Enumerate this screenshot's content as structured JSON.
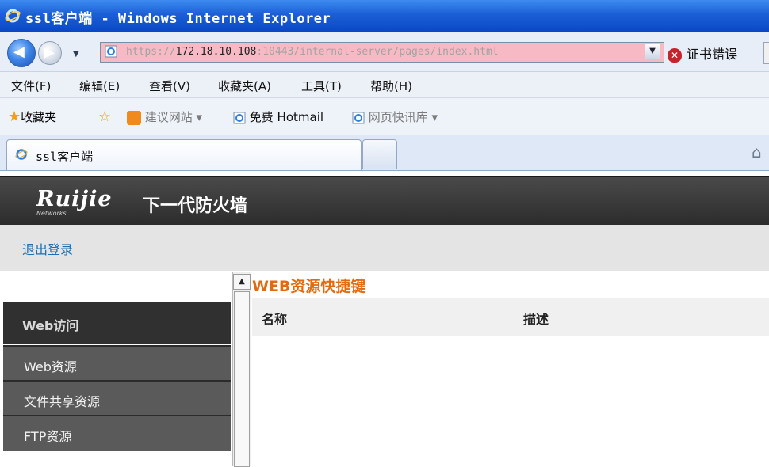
{
  "window": {
    "title": "ssl客户端 - Windows Internet Explorer"
  },
  "address_bar": {
    "scheme": "https://",
    "host": "172.18.10.108",
    "rest": ":10443/internal-server/pages/index.html",
    "cert_error": "证书错误",
    "color_error_bg": "#f7b9c4"
  },
  "menu": [
    "文件(F)",
    "编辑(E)",
    "查看(V)",
    "收藏夹(A)",
    "工具(T)",
    "帮助(H)"
  ],
  "favorites": {
    "label": "收藏夹",
    "items": [
      {
        "label": "建议网站 ▾",
        "icon": "suggested-sites-icon"
      },
      {
        "label": "免费 Hotmail",
        "icon": "ie-page-icon"
      },
      {
        "label": "网页快讯库 ▾",
        "icon": "web-slice-icon"
      }
    ]
  },
  "tab": {
    "label": "ssl客户端"
  },
  "page": {
    "brand": "Ruijie",
    "brand_sub": "Networks",
    "product": "下一代防火墙",
    "logout": "退出登录",
    "section_title": "WEB资源快捷键",
    "columns": [
      "名称",
      "描述"
    ],
    "sidebar": {
      "header": "Web访问",
      "items": [
        "Web资源",
        "文件共享资源",
        "FTP资源"
      ]
    },
    "accent_color": "#e26a10"
  }
}
